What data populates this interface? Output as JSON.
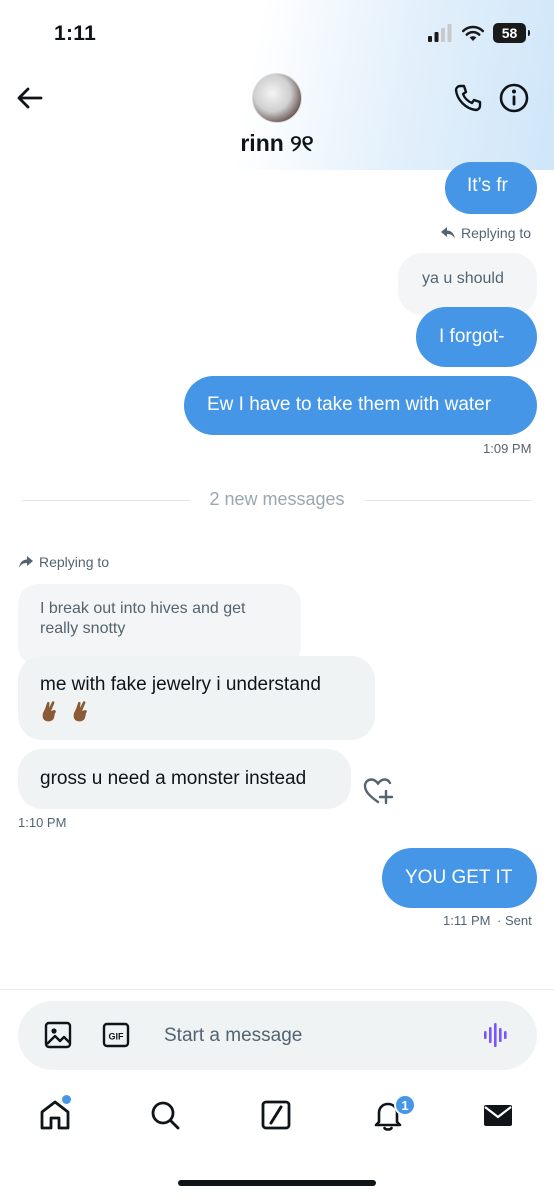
{
  "status_bar": {
    "time": "1:11",
    "battery": "58"
  },
  "header": {
    "contact_name": "rinn ୨୧"
  },
  "messages": {
    "sent_its_fr": "It’s fr",
    "reply_label_1": "Replying to",
    "quoted_1": "ya u should",
    "sent_i_forgot": "I forgot-",
    "sent_water": "Ew I have to take them with water",
    "time_109": "1:09 PM",
    "new_messages": "2 new messages",
    "reply_label_2": "Replying to",
    "quoted_2": "I break out into hives and get really snotty",
    "recv_jewelry": "me with fake jewelry i understand",
    "recv_monster": "gross u need a monster instead",
    "time_110": "1:10 PM",
    "sent_you_get_it": "YOU GET IT",
    "time_111": "1:11 PM",
    "sent_status": "· Sent"
  },
  "composer": {
    "placeholder": "Start a message"
  },
  "tab_bar": {
    "notifications_badge": "1"
  },
  "colors": {
    "accent": "#4596e6",
    "received_bubble": "#eff3f4",
    "voice_icon": "#7856ff"
  }
}
